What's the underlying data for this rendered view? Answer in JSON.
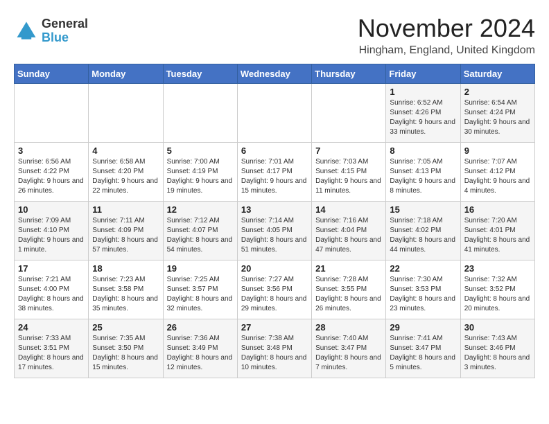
{
  "logo": {
    "general": "General",
    "blue": "Blue"
  },
  "title": "November 2024",
  "location": "Hingham, England, United Kingdom",
  "days_of_week": [
    "Sunday",
    "Monday",
    "Tuesday",
    "Wednesday",
    "Thursday",
    "Friday",
    "Saturday"
  ],
  "weeks": [
    [
      {
        "day": "",
        "info": ""
      },
      {
        "day": "",
        "info": ""
      },
      {
        "day": "",
        "info": ""
      },
      {
        "day": "",
        "info": ""
      },
      {
        "day": "",
        "info": ""
      },
      {
        "day": "1",
        "info": "Sunrise: 6:52 AM\nSunset: 4:26 PM\nDaylight: 9 hours and 33 minutes."
      },
      {
        "day": "2",
        "info": "Sunrise: 6:54 AM\nSunset: 4:24 PM\nDaylight: 9 hours and 30 minutes."
      }
    ],
    [
      {
        "day": "3",
        "info": "Sunrise: 6:56 AM\nSunset: 4:22 PM\nDaylight: 9 hours and 26 minutes."
      },
      {
        "day": "4",
        "info": "Sunrise: 6:58 AM\nSunset: 4:20 PM\nDaylight: 9 hours and 22 minutes."
      },
      {
        "day": "5",
        "info": "Sunrise: 7:00 AM\nSunset: 4:19 PM\nDaylight: 9 hours and 19 minutes."
      },
      {
        "day": "6",
        "info": "Sunrise: 7:01 AM\nSunset: 4:17 PM\nDaylight: 9 hours and 15 minutes."
      },
      {
        "day": "7",
        "info": "Sunrise: 7:03 AM\nSunset: 4:15 PM\nDaylight: 9 hours and 11 minutes."
      },
      {
        "day": "8",
        "info": "Sunrise: 7:05 AM\nSunset: 4:13 PM\nDaylight: 9 hours and 8 minutes."
      },
      {
        "day": "9",
        "info": "Sunrise: 7:07 AM\nSunset: 4:12 PM\nDaylight: 9 hours and 4 minutes."
      }
    ],
    [
      {
        "day": "10",
        "info": "Sunrise: 7:09 AM\nSunset: 4:10 PM\nDaylight: 9 hours and 1 minute."
      },
      {
        "day": "11",
        "info": "Sunrise: 7:11 AM\nSunset: 4:09 PM\nDaylight: 8 hours and 57 minutes."
      },
      {
        "day": "12",
        "info": "Sunrise: 7:12 AM\nSunset: 4:07 PM\nDaylight: 8 hours and 54 minutes."
      },
      {
        "day": "13",
        "info": "Sunrise: 7:14 AM\nSunset: 4:05 PM\nDaylight: 8 hours and 51 minutes."
      },
      {
        "day": "14",
        "info": "Sunrise: 7:16 AM\nSunset: 4:04 PM\nDaylight: 8 hours and 47 minutes."
      },
      {
        "day": "15",
        "info": "Sunrise: 7:18 AM\nSunset: 4:02 PM\nDaylight: 8 hours and 44 minutes."
      },
      {
        "day": "16",
        "info": "Sunrise: 7:20 AM\nSunset: 4:01 PM\nDaylight: 8 hours and 41 minutes."
      }
    ],
    [
      {
        "day": "17",
        "info": "Sunrise: 7:21 AM\nSunset: 4:00 PM\nDaylight: 8 hours and 38 minutes."
      },
      {
        "day": "18",
        "info": "Sunrise: 7:23 AM\nSunset: 3:58 PM\nDaylight: 8 hours and 35 minutes."
      },
      {
        "day": "19",
        "info": "Sunrise: 7:25 AM\nSunset: 3:57 PM\nDaylight: 8 hours and 32 minutes."
      },
      {
        "day": "20",
        "info": "Sunrise: 7:27 AM\nSunset: 3:56 PM\nDaylight: 8 hours and 29 minutes."
      },
      {
        "day": "21",
        "info": "Sunrise: 7:28 AM\nSunset: 3:55 PM\nDaylight: 8 hours and 26 minutes."
      },
      {
        "day": "22",
        "info": "Sunrise: 7:30 AM\nSunset: 3:53 PM\nDaylight: 8 hours and 23 minutes."
      },
      {
        "day": "23",
        "info": "Sunrise: 7:32 AM\nSunset: 3:52 PM\nDaylight: 8 hours and 20 minutes."
      }
    ],
    [
      {
        "day": "24",
        "info": "Sunrise: 7:33 AM\nSunset: 3:51 PM\nDaylight: 8 hours and 17 minutes."
      },
      {
        "day": "25",
        "info": "Sunrise: 7:35 AM\nSunset: 3:50 PM\nDaylight: 8 hours and 15 minutes."
      },
      {
        "day": "26",
        "info": "Sunrise: 7:36 AM\nSunset: 3:49 PM\nDaylight: 8 hours and 12 minutes."
      },
      {
        "day": "27",
        "info": "Sunrise: 7:38 AM\nSunset: 3:48 PM\nDaylight: 8 hours and 10 minutes."
      },
      {
        "day": "28",
        "info": "Sunrise: 7:40 AM\nSunset: 3:47 PM\nDaylight: 8 hours and 7 minutes."
      },
      {
        "day": "29",
        "info": "Sunrise: 7:41 AM\nSunset: 3:47 PM\nDaylight: 8 hours and 5 minutes."
      },
      {
        "day": "30",
        "info": "Sunrise: 7:43 AM\nSunset: 3:46 PM\nDaylight: 8 hours and 3 minutes."
      }
    ]
  ]
}
